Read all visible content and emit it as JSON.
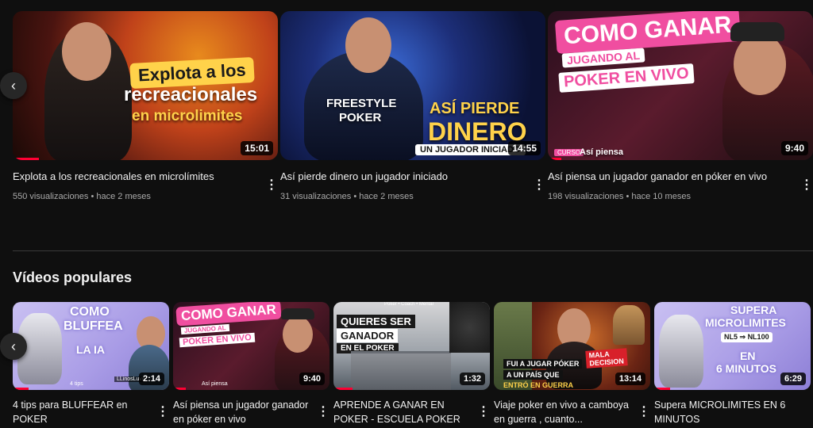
{
  "nav": {
    "prev_icon": "chevron-left-icon",
    "prev_glyph": "‹"
  },
  "latest": [
    {
      "title": "Explota a los recreacionales en microlímites",
      "views": "550 visualizaciones",
      "age": "hace 2 meses",
      "duration": "15:01",
      "thumb_text": [
        "Explota",
        "a los",
        "recreacionales",
        "en microlimites"
      ],
      "watched_fraction": 0.1
    },
    {
      "title": "Así pierde dinero un jugador iniciado",
      "views": "31 visualizaciones",
      "age": "hace 2 meses",
      "duration": "14:55",
      "thumb_text": [
        "FREESTYLE",
        "POKER",
        "ASÍ PIERDE",
        "DINERO",
        "UN JUGADOR INICIADO"
      ]
    },
    {
      "title": "Así piensa un jugador ganador en póker en vivo",
      "views": "198 visualizaciones",
      "age": "hace 10 meses",
      "duration": "9:40",
      "thumb_text": [
        "COMO GANAR",
        "JUGANDO AL",
        "POKER EN VIVO",
        "CURSO",
        "Así piensa"
      ],
      "watched_fraction": 0.05
    }
  ],
  "popular_section": {
    "title": "Vídeos populares"
  },
  "popular": [
    {
      "title": "4 tips para BLUFFEAR en POKER",
      "duration": "2:14",
      "thumb_text": [
        "COMO",
        "BLUFFEA",
        "LA IA",
        "4 tips",
        "LLinosLuve"
      ],
      "watched_fraction": 0.1
    },
    {
      "title": "Así piensa un jugador ganador en póker en vivo",
      "duration": "9:40",
      "thumb_text": [
        "COMO GANAR",
        "JUGANDO AL",
        "POKER EN VIVO",
        "Así piensa"
      ],
      "watched_fraction": 0.08
    },
    {
      "title": "APRENDE A GANAR EN POKER - ESCUELA POKER",
      "duration": "1:32",
      "thumb_text": [
        "Poker • Coach • Mental",
        "QUIERES SER",
        "GANADOR",
        "EN EL POKER"
      ],
      "watched_fraction": 0.12
    },
    {
      "title": "Viaje poker en vivo a camboya en guerra , cuanto...",
      "duration": "13:14",
      "thumb_text": [
        "FUI A JUGAR PÓKER",
        "A UN PAÍS QUE",
        "ENTRÓ EN GUERRA",
        "MALA",
        "DECISION"
      ]
    },
    {
      "title": "Supera MICROLIMITES EN 6 MINUTOS",
      "duration": "6:29",
      "thumb_text": [
        "SUPERA",
        "MICROLIMITES",
        "NL5",
        "NL100",
        "EN",
        "6 MINUTOS"
      ],
      "watched_fraction": 0.1
    }
  ],
  "more_glyph": "⋮",
  "colors": {
    "background": "#0f0f0f",
    "progress": "#ff0033",
    "text_primary": "#f1f1f1",
    "text_secondary": "#aaaaaa"
  }
}
